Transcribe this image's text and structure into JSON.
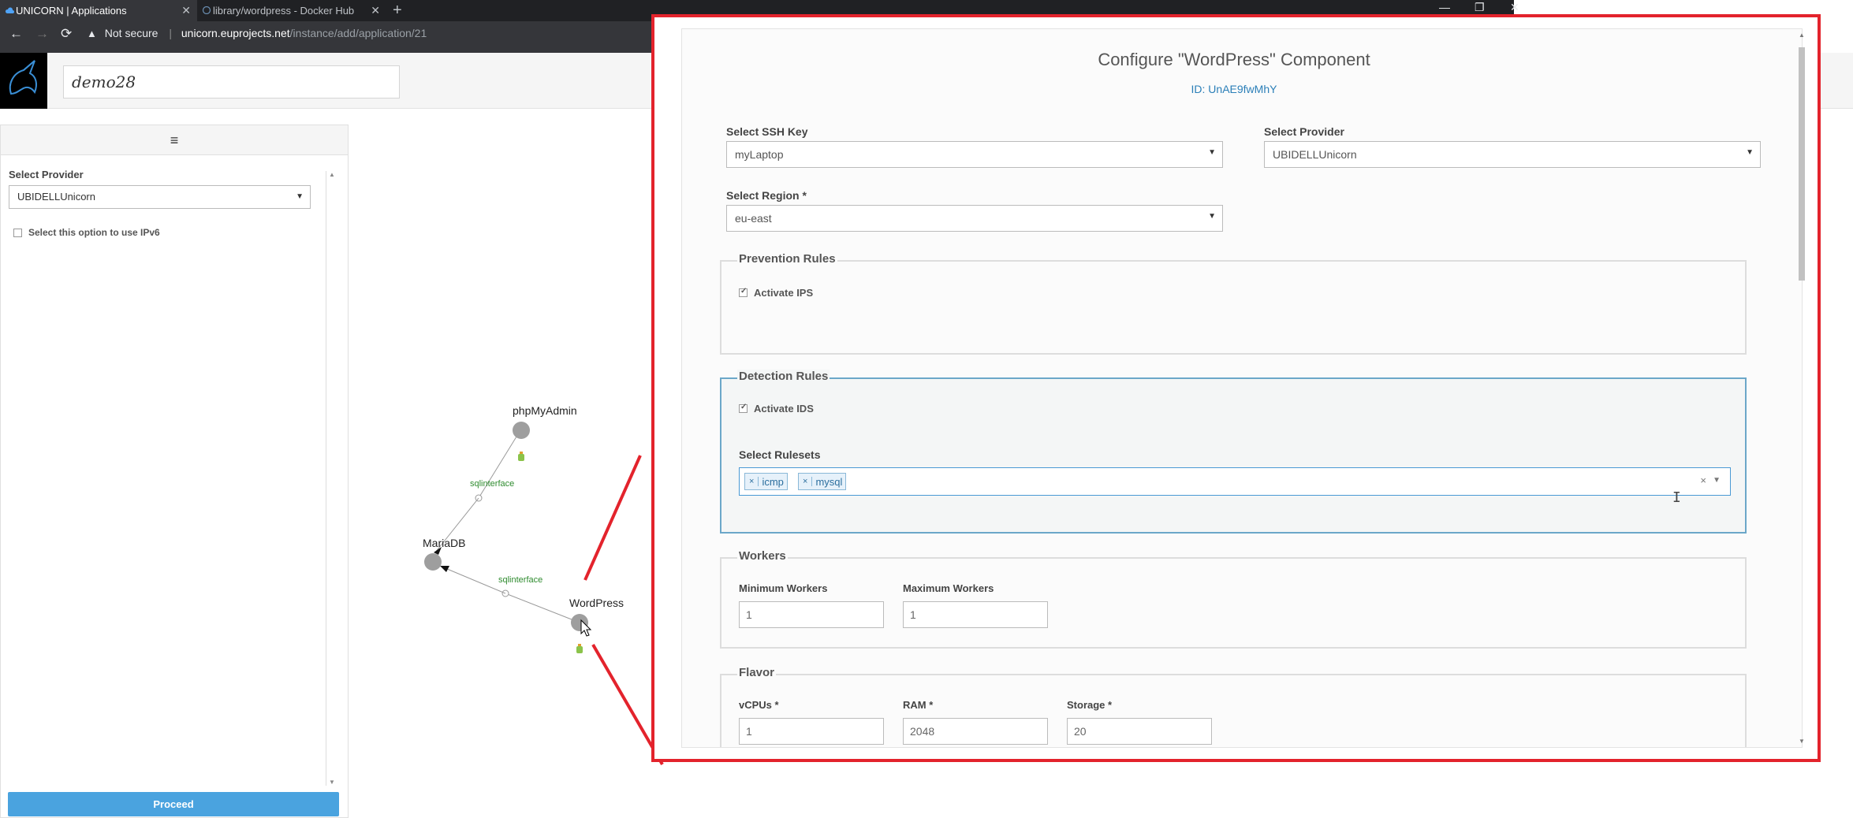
{
  "browser": {
    "tabs": [
      {
        "title": "UNICORN | Applications",
        "active": true
      },
      {
        "title": "library/wordpress - Docker Hub",
        "active": false
      }
    ],
    "new_tab": "+",
    "security_label": "Not secure",
    "url_host": "unicorn.euprojects.net",
    "url_path": "/instance/add/application/21"
  },
  "app": {
    "instance_name": "demo28"
  },
  "left_panel": {
    "menu_glyph": "≡",
    "provider_label": "Select Provider",
    "provider_value": "UBIDELLUnicorn",
    "ipv6_label": "Select this option to use IPv6",
    "proceed_label": "Proceed"
  },
  "graph": {
    "nodes": [
      {
        "name": "phpMyAdmin"
      },
      {
        "name": "MariaDB"
      },
      {
        "name": "WordPress"
      }
    ],
    "edges": [
      {
        "label": "sqlinterface"
      },
      {
        "label": "sqlinterface"
      }
    ]
  },
  "modal": {
    "title": "Configure \"WordPress\" Component",
    "id_text": "ID: UnAE9fwMhY",
    "ssh_key_label": "Select SSH Key",
    "ssh_key_value": "myLaptop",
    "provider_label": "Select Provider",
    "provider_value": "UBIDELLUnicorn",
    "region_label": "Select Region *",
    "region_value": "eu-east",
    "prevention": {
      "legend": "Prevention Rules",
      "checkbox_label": "Activate IPS",
      "checked": true
    },
    "detection": {
      "legend": "Detection Rules",
      "checkbox_label": "Activate IDS",
      "checked": true,
      "rulesets_label": "Select Rulesets",
      "rulesets": [
        "icmp",
        "mysql"
      ],
      "clear_glyph": "×",
      "chip_remove_glyph": "×"
    },
    "workers": {
      "legend": "Workers",
      "min_label": "Minimum Workers",
      "min_value": "1",
      "max_label": "Maximum Workers",
      "max_value": "1"
    },
    "flavor": {
      "legend": "Flavor",
      "vcpus_label": "vCPUs *",
      "vcpus_value": "1",
      "ram_label": "RAM *",
      "ram_value": "2048",
      "storage_label": "Storage *",
      "storage_value": "20"
    }
  },
  "colors": {
    "callout": "#e3232c",
    "primary_button": "#4aa3df",
    "edge_label": "#2e8b2e",
    "node": "#9e9e9e"
  }
}
